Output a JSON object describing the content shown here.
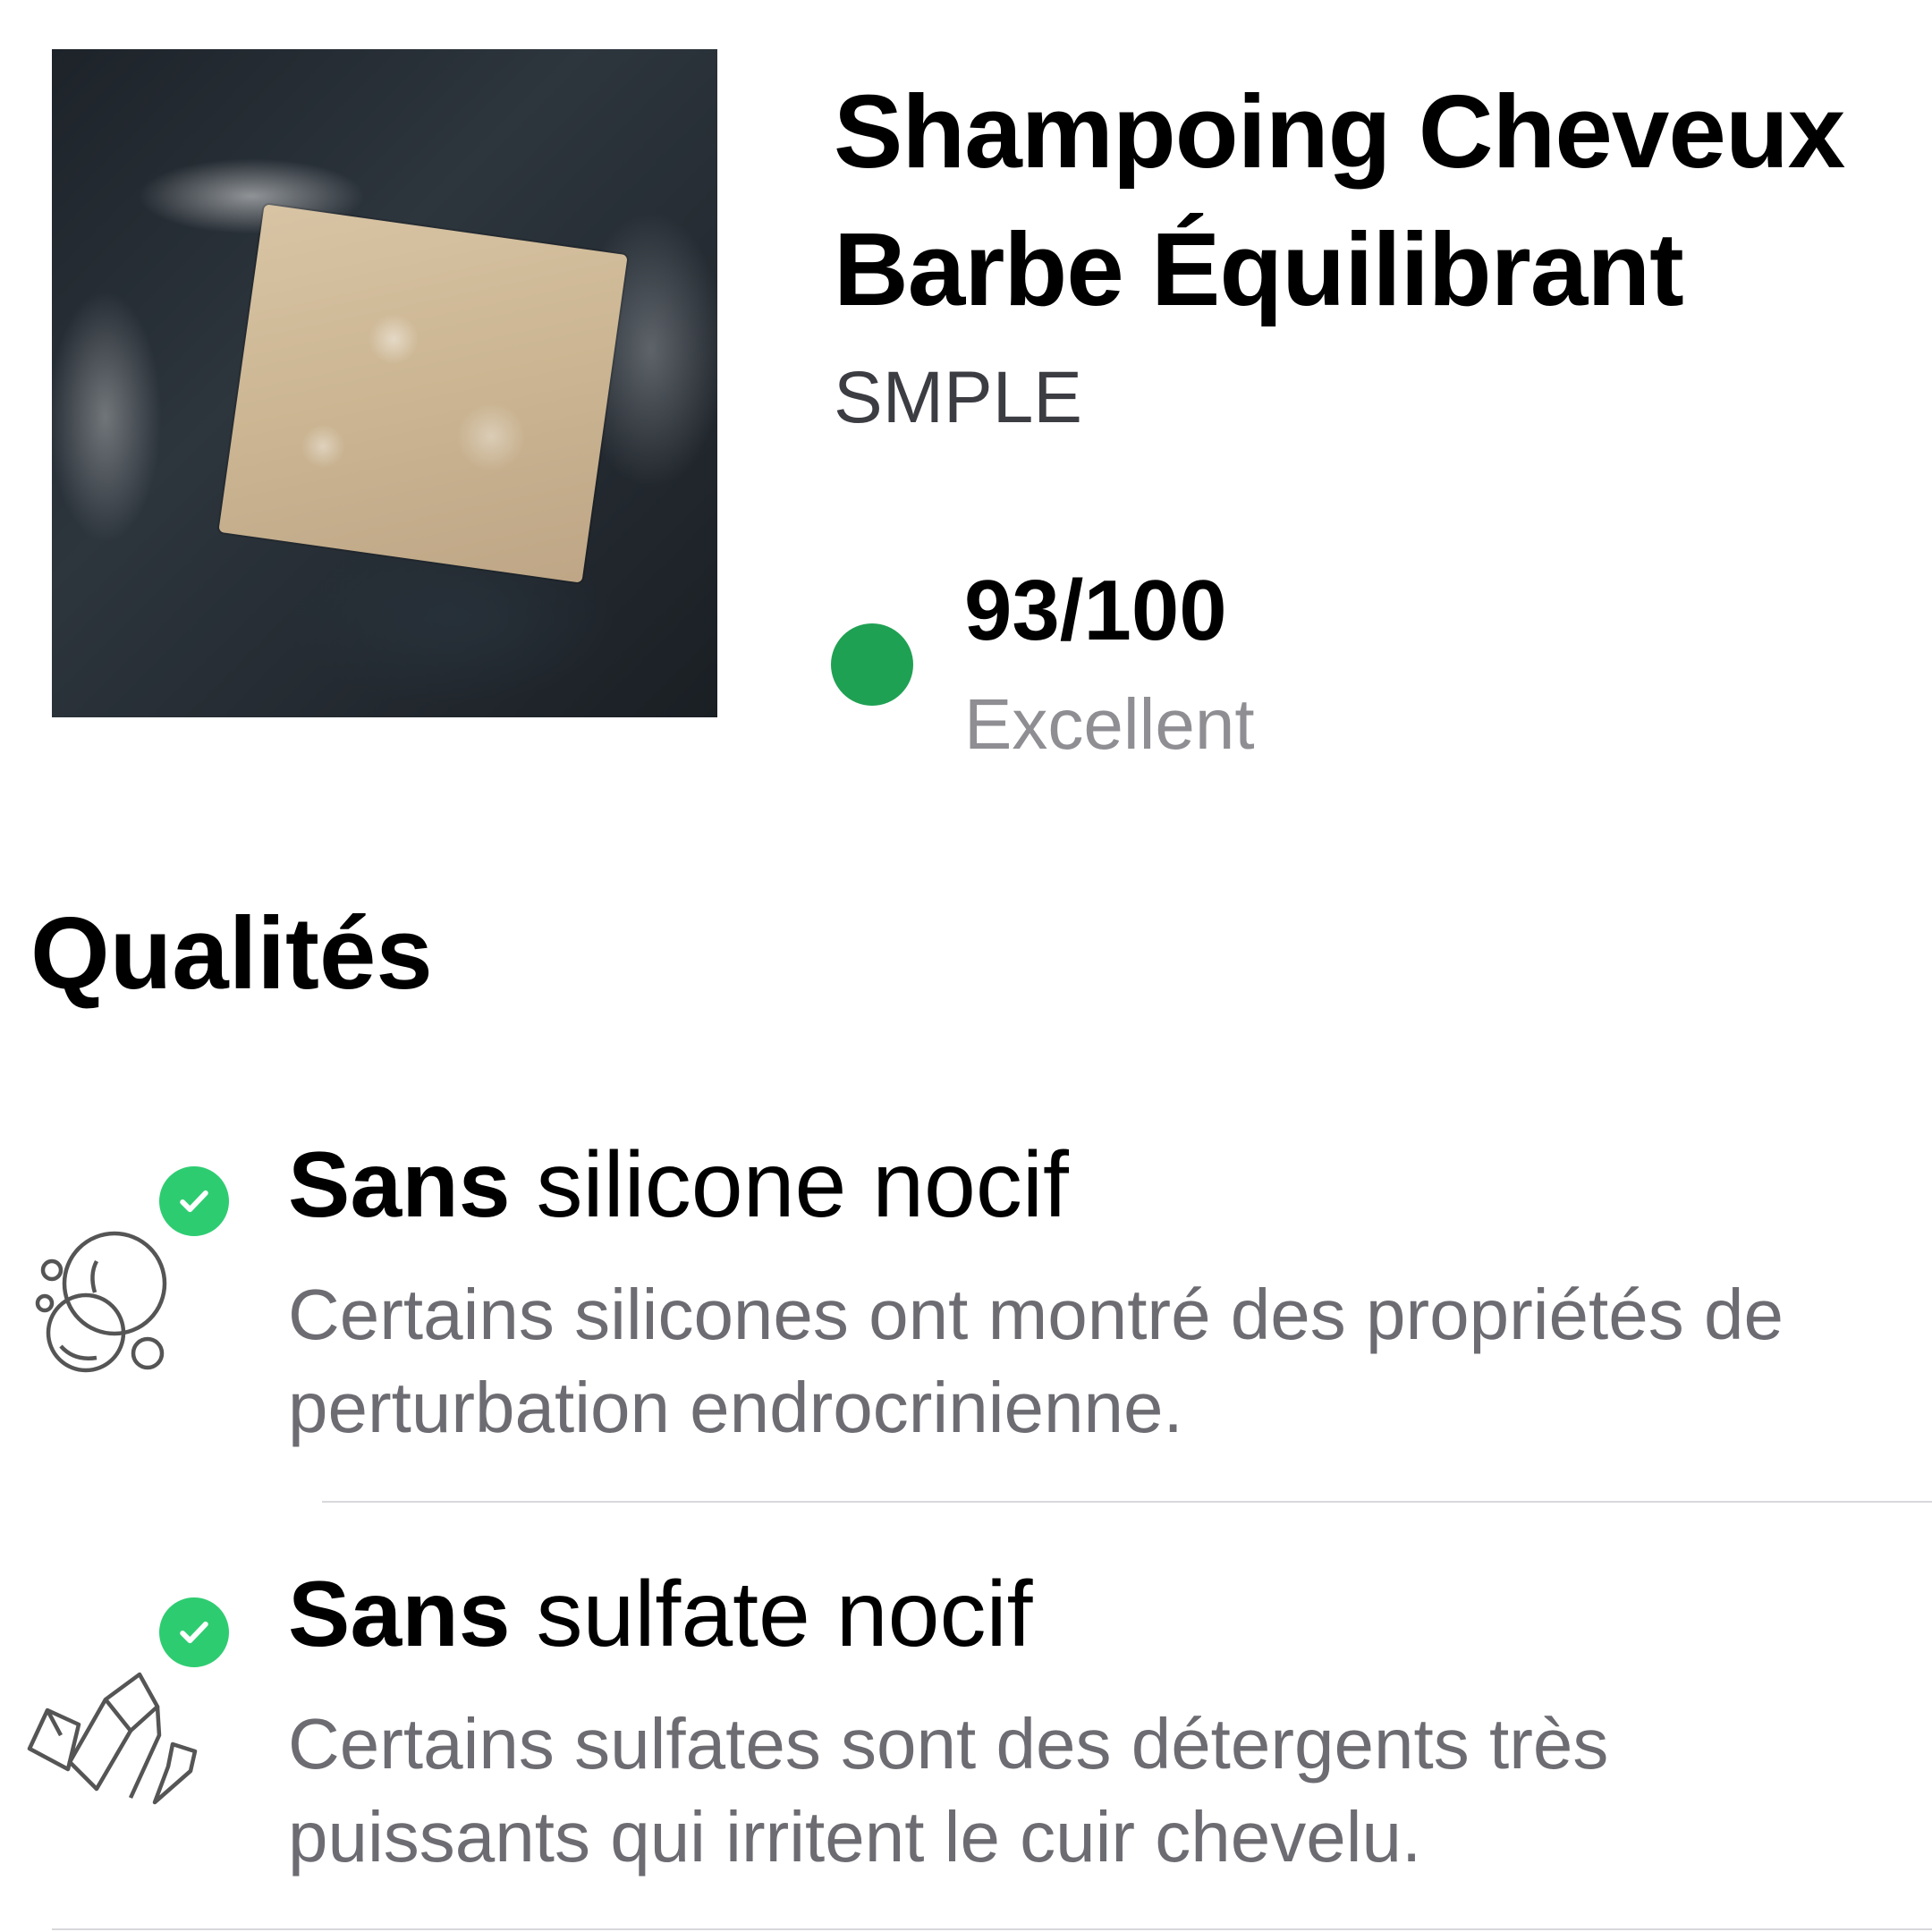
{
  "product": {
    "title": "Shampoing Cheveux Barbe Équilibrant",
    "brand": "SMPLE",
    "score": "93/100",
    "rating": "Excellent",
    "score_color": "#1fa153",
    "image_alt": "Savon barre moussant sur fond sombre"
  },
  "qualities": {
    "heading": "Qualités",
    "check_color": "#2ecc71",
    "items": [
      {
        "icon": "bubbles-icon",
        "title_bold": "Sans",
        "title_rest": " silicone nocif",
        "description": "Certains silicones ont montré des propriétés de perturbation endrocrinienne."
      },
      {
        "icon": "crystals-icon",
        "title_bold": "Sans",
        "title_rest": " sulfate nocif",
        "description": "Certains sulfates sont des détergents très puissants qui irritent le cuir chevelu."
      }
    ]
  }
}
